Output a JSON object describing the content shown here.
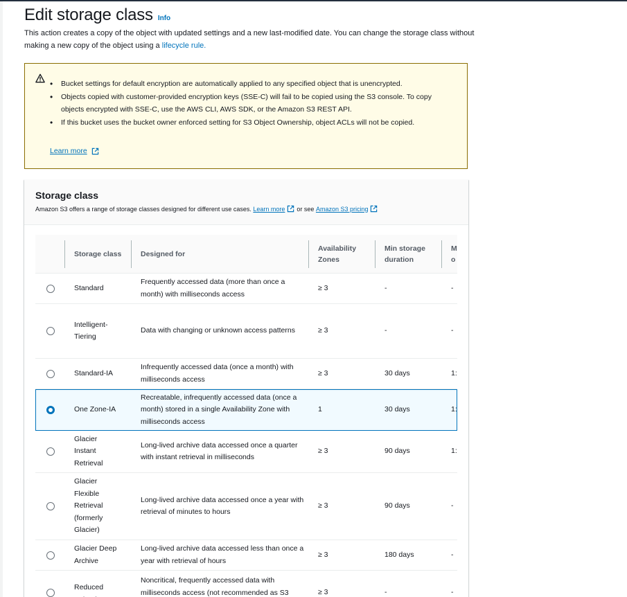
{
  "header": {
    "title": "Edit storage class",
    "info_label": "Info",
    "description": "This action creates a copy of the object with updated settings and a new last-modified date. You can change the storage class without making a new copy of the object using a",
    "description_link": "lifecycle rule."
  },
  "alert": {
    "icon": "warning-icon",
    "items": [
      "Bucket settings for default encryption are automatically applied to any specified object that is unencrypted.",
      "Objects copied with customer-provided encryption keys (SSE-C) will fail to be copied using the S3 console. To copy objects encrypted with SSE-C, use the AWS CLI, AWS SDK, or the Amazon S3 REST API.",
      "If this bucket uses the bucket owner enforced setting for S3 Object Ownership, object ACLs will not be copied."
    ],
    "learn_more": "Learn more"
  },
  "storage_class": {
    "title": "Storage class",
    "subtitle": "Amazon S3 offers a range of storage classes designed for different use cases.",
    "learn_more": "Learn more",
    "or_see": "or see",
    "pricing_link": "Amazon S3 pricing",
    "columns": {
      "storage_class": "Storage class",
      "designed_for": "Designed for",
      "availability_zones": "Availability Zones",
      "min_storage_duration": "Min storage duration",
      "truncated": "M o"
    },
    "rows": [
      {
        "name": "Standard",
        "designed_for": "Frequently accessed data (more than once a month) with milliseconds access",
        "az": "≥ 3",
        "min": "-",
        "extra": "-",
        "selected": false
      },
      {
        "name": "Intelligent-Tiering",
        "designed_for": "Data with changing or unknown access patterns",
        "az": "≥ 3",
        "min": "-",
        "extra": "-",
        "selected": false
      },
      {
        "name": "Standard-IA",
        "designed_for": "Infrequently accessed data (once a month) with milliseconds access",
        "az": "≥ 3",
        "min": "30 days",
        "extra": "1:",
        "selected": false
      },
      {
        "name": "One Zone-IA",
        "designed_for": "Recreatable, infrequently accessed data (once a month) stored in a single Availability Zone with milliseconds access",
        "az": "1",
        "min": "30 days",
        "extra": "1:",
        "selected": true
      },
      {
        "name": "Glacier Instant Retrieval",
        "designed_for": "Long-lived archive data accessed once a quarter with instant retrieval in milliseconds",
        "az": "≥ 3",
        "min": "90 days",
        "extra": "1:",
        "selected": false
      },
      {
        "name": "Glacier Flexible Retrieval (formerly Glacier)",
        "designed_for": "Long-lived archive data accessed once a year with retrieval of minutes to hours",
        "az": "≥ 3",
        "min": "90 days",
        "extra": "-",
        "selected": false
      },
      {
        "name": "Glacier Deep Archive",
        "designed_for": "Long-lived archive data accessed less than once a year with retrieval of hours",
        "az": "≥ 3",
        "min": "180 days",
        "extra": "-",
        "selected": false
      },
      {
        "name": "Reduced redundancy",
        "designed_for": "Noncritical, frequently accessed data with milliseconds access (not recommended as S3",
        "az": "≥ 3",
        "min": "-",
        "extra": "-",
        "selected": false
      }
    ]
  }
}
